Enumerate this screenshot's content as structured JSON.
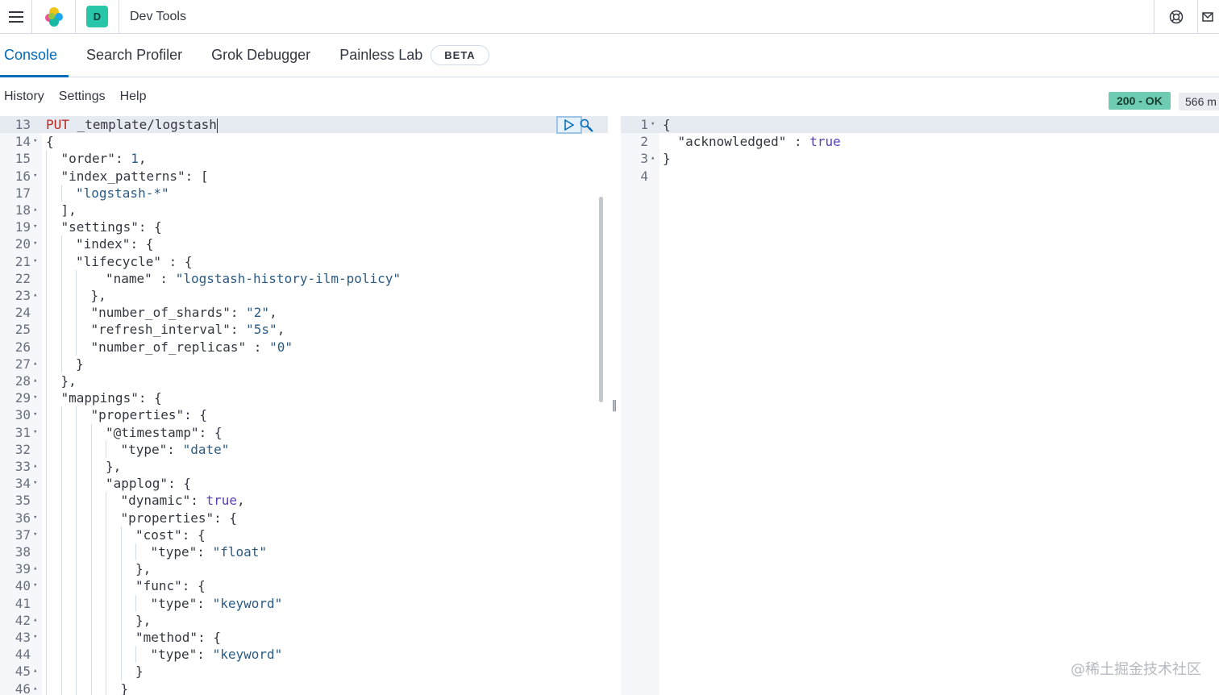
{
  "header": {
    "app_title": "Dev Tools",
    "space_avatar": "D",
    "icons": [
      "menu-icon",
      "elastic-logo-icon",
      "help-icon",
      "mail-icon"
    ]
  },
  "tabs": [
    {
      "label": "Console",
      "active": true
    },
    {
      "label": "Search Profiler",
      "active": false
    },
    {
      "label": "Grok Debugger",
      "active": false
    },
    {
      "label": "Painless Lab",
      "active": false,
      "badge": "BETA"
    }
  ],
  "menu": {
    "history": "History",
    "settings": "Settings",
    "help": "Help"
  },
  "response_status": {
    "status": "200 - OK",
    "time": "566 m"
  },
  "request_editor": {
    "lines": [
      {
        "n": "13",
        "fold": "",
        "text": "_template/logstash"
      },
      {
        "n": "14",
        "fold": "▾",
        "text": "{"
      },
      {
        "n": "15",
        "fold": "",
        "text": "\"order\": 1,"
      },
      {
        "n": "16",
        "fold": "▾",
        "text": "\"index_patterns\": ["
      },
      {
        "n": "17",
        "fold": "",
        "text": "\"logstash-*\""
      },
      {
        "n": "18",
        "fold": "▴",
        "text": "],"
      },
      {
        "n": "19",
        "fold": "▾",
        "text": "\"settings\": {"
      },
      {
        "n": "20",
        "fold": "▾",
        "text": "\"index\": {"
      },
      {
        "n": "21",
        "fold": "▾",
        "text": "\"lifecycle\" : {"
      },
      {
        "n": "22",
        "fold": "",
        "text": "\"name\" : \"logstash-history-ilm-policy\""
      },
      {
        "n": "23",
        "fold": "▴",
        "text": "},"
      },
      {
        "n": "24",
        "fold": "",
        "text": "\"number_of_shards\": \"2\","
      },
      {
        "n": "25",
        "fold": "",
        "text": "\"refresh_interval\": \"5s\","
      },
      {
        "n": "26",
        "fold": "",
        "text": "\"number_of_replicas\" : \"0\""
      },
      {
        "n": "27",
        "fold": "▴",
        "text": "}"
      },
      {
        "n": "28",
        "fold": "▴",
        "text": "},"
      },
      {
        "n": "29",
        "fold": "▾",
        "text": "\"mappings\": {"
      },
      {
        "n": "30",
        "fold": "▾",
        "text": "\"properties\": {"
      },
      {
        "n": "31",
        "fold": "▾",
        "text": "\"@timestamp\": {"
      },
      {
        "n": "32",
        "fold": "",
        "text": "\"type\": \"date\""
      },
      {
        "n": "33",
        "fold": "▴",
        "text": "},"
      },
      {
        "n": "34",
        "fold": "▾",
        "text": "\"applog\": {"
      },
      {
        "n": "35",
        "fold": "",
        "text": "\"dynamic\": true,"
      },
      {
        "n": "36",
        "fold": "▾",
        "text": "\"properties\": {"
      },
      {
        "n": "37",
        "fold": "▾",
        "text": "\"cost\": {"
      },
      {
        "n": "38",
        "fold": "",
        "text": "\"type\": \"float\""
      },
      {
        "n": "39",
        "fold": "▴",
        "text": "},"
      },
      {
        "n": "40",
        "fold": "▾",
        "text": "\"func\": {"
      },
      {
        "n": "41",
        "fold": "",
        "text": "\"type\": \"keyword\""
      },
      {
        "n": "42",
        "fold": "▴",
        "text": "},"
      },
      {
        "n": "43",
        "fold": "▾",
        "text": "\"method\": {"
      },
      {
        "n": "44",
        "fold": "",
        "text": "\"type\": \"keyword\""
      },
      {
        "n": "45",
        "fold": "▴",
        "text": "}"
      },
      {
        "n": "46",
        "fold": "▴",
        "text": "}"
      }
    ],
    "method": "PUT"
  },
  "response_editor": {
    "lines": [
      {
        "n": "1",
        "fold": "▾",
        "text": "{"
      },
      {
        "n": "2",
        "fold": "",
        "text": "\"acknowledged\" : true"
      },
      {
        "n": "3",
        "fold": "▴",
        "text": "}"
      },
      {
        "n": "4",
        "fold": "",
        "text": ""
      }
    ]
  },
  "watermark": "@稀土掘金技术社区"
}
